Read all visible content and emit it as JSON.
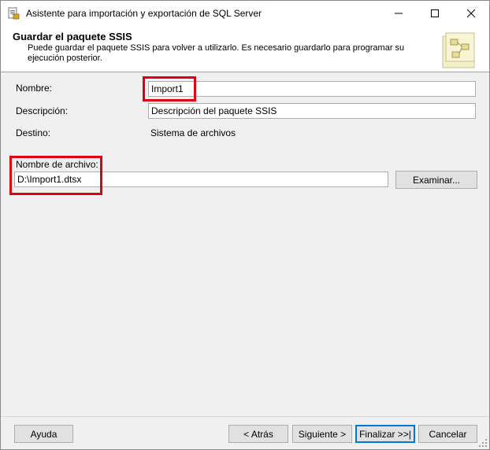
{
  "window": {
    "title": "Asistente para importación y exportación de SQL Server",
    "controls": {
      "minimize": "minimize-icon",
      "maximize": "maximize-icon",
      "close": "close-icon"
    }
  },
  "header": {
    "title": "Guardar el paquete SSIS",
    "description": "Puede guardar el paquete SSIS para volver a utilizarlo. Es necesario guardarlo para programar su ejecución posterior."
  },
  "form": {
    "name_label": "Nombre:",
    "name_value": "Import1",
    "description_label": "Descripción:",
    "description_value": "Descripción del paquete SSIS",
    "destination_label": "Destino:",
    "destination_value": "Sistema de archivos",
    "filename_label": "Nombre de archivo:",
    "filename_value": "D:\\Import1.dtsx",
    "browse_label": "Examinar..."
  },
  "footer": {
    "help": "Ayuda",
    "back": "< Atrás",
    "next": "Siguiente >",
    "finish": "Finalizar >>|",
    "cancel": "Cancelar"
  },
  "colors": {
    "highlight": "#e0000f",
    "accent": "#0078d7"
  }
}
